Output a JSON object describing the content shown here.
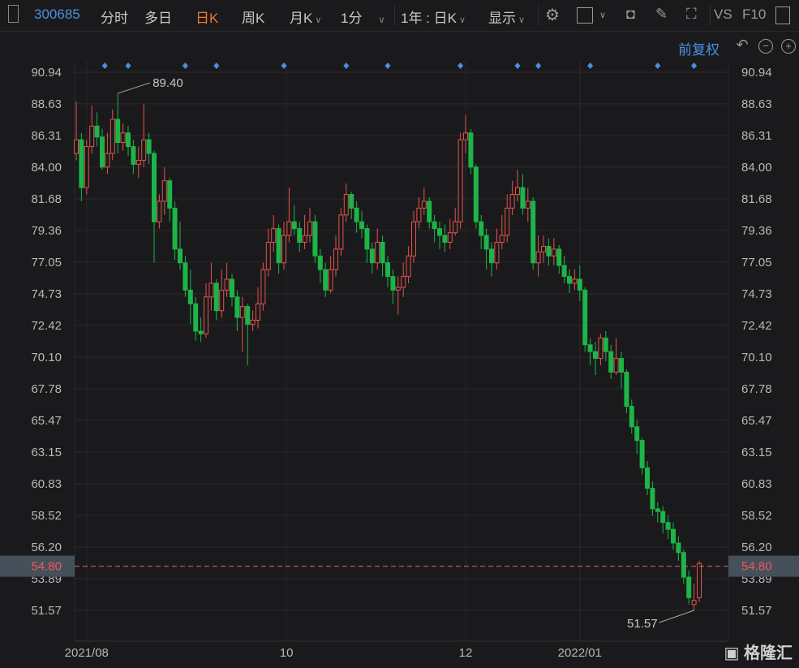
{
  "toolbar": {
    "stock_code": "300685",
    "items": [
      "分时",
      "多日",
      "日K",
      "周K",
      "月K",
      "1分",
      "1年 : 日K",
      "显示"
    ],
    "active": "日K",
    "vs_label": "VS",
    "f10_label": "F10"
  },
  "adjust_label": "前复权",
  "watermark": "格隆汇",
  "colors": {
    "up": "#e5534b",
    "down": "#1db548",
    "accent": "#4a90e2",
    "active": "#f07a28",
    "price_line": "#e0674a"
  },
  "chart_data": {
    "type": "candlestick",
    "ylim": [
      49.5,
      91.8
    ],
    "y_ticks": [
      "90.94",
      "88.63",
      "86.31",
      "84.00",
      "81.68",
      "79.36",
      "77.05",
      "74.73",
      "72.42",
      "70.10",
      "67.78",
      "65.47",
      "63.15",
      "60.83",
      "58.52",
      "56.20",
      "53.89",
      "51.57"
    ],
    "x_ticks": [
      {
        "label": "2021/08",
        "index": 2
      },
      {
        "label": "10",
        "index": 40.5
      },
      {
        "label": "12",
        "index": 75
      },
      {
        "label": "2022/01",
        "index": 97
      }
    ],
    "current_price": "54.80",
    "max_annotation": {
      "label": "89.40",
      "index": 8,
      "value": 89.4
    },
    "min_annotation": {
      "label": "51.57",
      "index": 119,
      "value": 51.57
    },
    "event_marker_indices": [
      5.5,
      10,
      21,
      27,
      40,
      52,
      60,
      74,
      85,
      89,
      99,
      112,
      119
    ],
    "candles_ohlc": [
      [
        85.0,
        88.8,
        84.5,
        86.0
      ],
      [
        86.0,
        86.5,
        81.5,
        82.5
      ],
      [
        82.5,
        86.0,
        82.0,
        85.5
      ],
      [
        85.5,
        88.5,
        85.0,
        87.0
      ],
      [
        87.0,
        88.0,
        85.5,
        86.2
      ],
      [
        86.2,
        86.8,
        83.8,
        84.0
      ],
      [
        84.0,
        86.5,
        83.5,
        85.0
      ],
      [
        85.0,
        88.2,
        84.5,
        87.5
      ],
      [
        87.5,
        89.4,
        85.0,
        85.8
      ],
      [
        85.8,
        87.2,
        85.2,
        86.5
      ],
      [
        86.5,
        87.0,
        84.8,
        85.5
      ],
      [
        85.5,
        86.0,
        83.5,
        84.2
      ],
      [
        84.2,
        85.5,
        83.2,
        84.5
      ],
      [
        84.5,
        88.6,
        84.0,
        86.0
      ],
      [
        86.0,
        86.5,
        84.2,
        85.0
      ],
      [
        85.0,
        85.2,
        77.0,
        80.0
      ],
      [
        80.0,
        82.0,
        79.5,
        81.5
      ],
      [
        81.5,
        84.0,
        80.5,
        83.0
      ],
      [
        83.0,
        83.2,
        80.0,
        81.0
      ],
      [
        81.0,
        81.5,
        77.2,
        78.0
      ],
      [
        78.0,
        80.0,
        76.5,
        77.0
      ],
      [
        77.0,
        77.5,
        74.5,
        75.0
      ],
      [
        75.0,
        76.5,
        72.5,
        74.0
      ],
      [
        74.0,
        74.5,
        71.3,
        72.0
      ],
      [
        72.0,
        73.0,
        71.2,
        71.8
      ],
      [
        71.8,
        75.5,
        71.5,
        74.5
      ],
      [
        74.5,
        77.0,
        73.5,
        75.5
      ],
      [
        75.5,
        75.8,
        72.8,
        73.5
      ],
      [
        73.5,
        76.5,
        73.0,
        75.0
      ],
      [
        75.0,
        77.0,
        74.5,
        75.8
      ],
      [
        75.8,
        76.2,
        73.8,
        74.5
      ],
      [
        74.5,
        75.0,
        72.0,
        73.0
      ],
      [
        73.0,
        74.5,
        70.5,
        73.8
      ],
      [
        73.8,
        74.0,
        69.5,
        72.5
      ],
      [
        72.5,
        73.5,
        72.0,
        72.8
      ],
      [
        72.8,
        75.2,
        72.2,
        74.0
      ],
      [
        74.0,
        77.0,
        73.5,
        76.5
      ],
      [
        76.5,
        79.5,
        76.0,
        78.5
      ],
      [
        78.5,
        80.5,
        77.8,
        79.5
      ],
      [
        79.5,
        79.8,
        76.2,
        77.0
      ],
      [
        77.0,
        80.0,
        76.5,
        79.0
      ],
      [
        79.0,
        82.5,
        78.5,
        80.0
      ],
      [
        80.0,
        81.2,
        79.0,
        79.5
      ],
      [
        79.5,
        80.0,
        77.8,
        78.5
      ],
      [
        78.5,
        80.5,
        78.0,
        79.0
      ],
      [
        79.0,
        81.0,
        78.5,
        80.0
      ],
      [
        80.0,
        80.5,
        77.0,
        77.5
      ],
      [
        77.5,
        78.0,
        75.5,
        76.5
      ],
      [
        76.5,
        77.0,
        74.5,
        75.0
      ],
      [
        75.0,
        77.5,
        74.8,
        76.5
      ],
      [
        76.5,
        79.0,
        76.0,
        78.0
      ],
      [
        78.0,
        81.0,
        77.5,
        80.5
      ],
      [
        80.5,
        82.8,
        80.0,
        82.0
      ],
      [
        82.0,
        82.2,
        80.2,
        81.0
      ],
      [
        81.0,
        81.5,
        79.2,
        80.0
      ],
      [
        80.0,
        80.8,
        78.8,
        79.5
      ],
      [
        79.5,
        79.8,
        77.0,
        78.0
      ],
      [
        78.0,
        78.5,
        76.2,
        77.0
      ],
      [
        77.0,
        79.5,
        76.5,
        78.5
      ],
      [
        78.5,
        79.0,
        76.0,
        77.0
      ],
      [
        77.0,
        77.5,
        75.2,
        76.0
      ],
      [
        76.0,
        76.5,
        74.0,
        75.0
      ],
      [
        75.0,
        76.0,
        73.2,
        75.2
      ],
      [
        75.2,
        77.0,
        74.5,
        76.0
      ],
      [
        76.0,
        78.2,
        75.5,
        77.5
      ],
      [
        77.5,
        80.8,
        77.0,
        80.0
      ],
      [
        80.0,
        81.8,
        79.5,
        81.0
      ],
      [
        81.0,
        82.5,
        80.5,
        81.5
      ],
      [
        81.5,
        81.8,
        79.5,
        80.0
      ],
      [
        80.0,
        80.5,
        78.5,
        79.5
      ],
      [
        79.5,
        80.0,
        78.0,
        79.0
      ],
      [
        79.0,
        79.8,
        77.8,
        78.5
      ],
      [
        78.5,
        80.2,
        78.0,
        79.2
      ],
      [
        79.2,
        81.0,
        79.0,
        80.0
      ],
      [
        80.0,
        86.5,
        79.5,
        86.0
      ],
      [
        86.0,
        87.8,
        85.0,
        86.5
      ],
      [
        86.5,
        86.8,
        83.5,
        84.0
      ],
      [
        84.0,
        84.2,
        79.5,
        80.0
      ],
      [
        80.0,
        80.5,
        78.0,
        79.0
      ],
      [
        79.0,
        79.5,
        76.5,
        78.0
      ],
      [
        78.0,
        78.5,
        76.0,
        77.0
      ],
      [
        77.0,
        79.5,
        76.5,
        78.5
      ],
      [
        78.5,
        80.5,
        78.0,
        79.0
      ],
      [
        79.0,
        82.0,
        78.5,
        81.0
      ],
      [
        81.0,
        83.0,
        80.5,
        82.0
      ],
      [
        82.0,
        83.8,
        81.5,
        82.5
      ],
      [
        82.5,
        83.5,
        80.5,
        81.0
      ],
      [
        81.0,
        82.5,
        80.0,
        81.5
      ],
      [
        81.5,
        81.8,
        76.5,
        77.0
      ],
      [
        77.0,
        79.0,
        76.0,
        77.8
      ],
      [
        77.8,
        79.0,
        77.0,
        78.2
      ],
      [
        78.2,
        78.8,
        76.8,
        77.5
      ],
      [
        77.5,
        78.8,
        76.8,
        78.0
      ],
      [
        78.0,
        78.3,
        76.2,
        76.8
      ],
      [
        76.8,
        77.5,
        75.5,
        76.0
      ],
      [
        76.0,
        76.5,
        74.8,
        75.5
      ],
      [
        75.5,
        76.5,
        75.0,
        75.8
      ],
      [
        75.8,
        76.8,
        74.2,
        75.0
      ],
      [
        75.0,
        75.2,
        70.5,
        71.0
      ],
      [
        71.0,
        71.5,
        69.5,
        70.5
      ],
      [
        70.5,
        71.2,
        68.8,
        70.0
      ],
      [
        70.0,
        71.8,
        69.5,
        71.5
      ],
      [
        71.5,
        72.0,
        69.8,
        70.5
      ],
      [
        70.5,
        71.0,
        68.5,
        69.0
      ],
      [
        69.0,
        71.5,
        68.8,
        70.0
      ],
      [
        70.0,
        70.5,
        67.8,
        69.0
      ],
      [
        69.0,
        69.2,
        66.0,
        66.5
      ],
      [
        66.5,
        67.0,
        64.5,
        65.0
      ],
      [
        65.0,
        65.5,
        63.0,
        64.0
      ],
      [
        64.0,
        64.2,
        61.5,
        62.0
      ],
      [
        62.0,
        62.5,
        60.0,
        60.5
      ],
      [
        60.5,
        61.0,
        58.5,
        59.0
      ],
      [
        59.0,
        59.5,
        58.0,
        58.8
      ],
      [
        58.8,
        59.2,
        57.2,
        58.0
      ],
      [
        58.0,
        58.5,
        56.8,
        57.5
      ],
      [
        57.5,
        58.0,
        56.0,
        56.5
      ],
      [
        56.5,
        57.0,
        55.2,
        55.8
      ],
      [
        55.8,
        56.0,
        53.5,
        54.0
      ],
      [
        54.0,
        54.5,
        52.0,
        52.5
      ],
      [
        52.0,
        53.5,
        51.57,
        52.3
      ],
      [
        52.5,
        55.2,
        52.2,
        55.0
      ]
    ]
  }
}
